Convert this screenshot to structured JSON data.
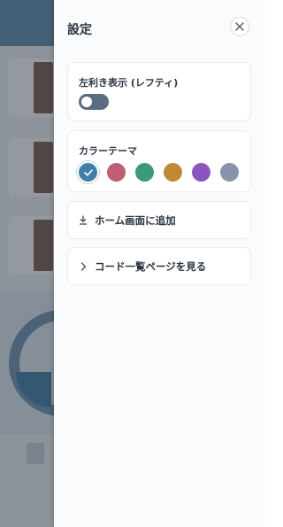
{
  "drawer": {
    "title": "設定"
  },
  "left_hand": {
    "label": "左利き表示 (レフティ)",
    "enabled": false
  },
  "theme": {
    "label": "カラーテーマ",
    "colors": [
      "#3f7fa8",
      "#c05f74",
      "#3a9a7c",
      "#c08a35",
      "#8c54c0",
      "#8794aa"
    ],
    "selected_index": 0
  },
  "actions": {
    "add_home": "ホーム画面に追加",
    "code_list": "コード一覧ページを見る"
  },
  "icons": {
    "close": "close-icon",
    "check": "check-icon",
    "download": "download-icon",
    "chevron": "chevron-right-icon"
  }
}
